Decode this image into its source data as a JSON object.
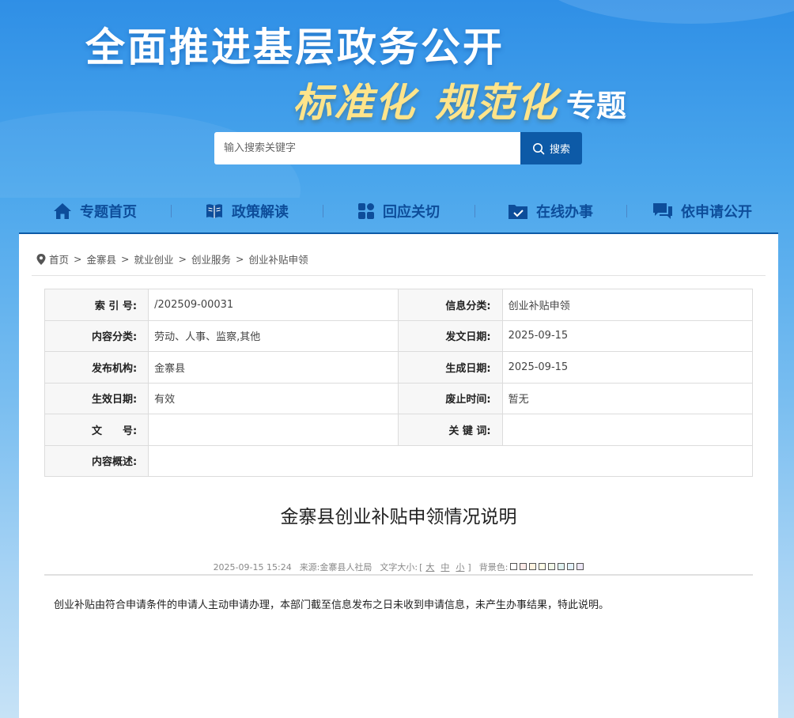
{
  "banner": {
    "title_main": "全面推进基层政务公开",
    "title_cal_1": "标准化",
    "title_cal_2": "规范化",
    "title_topic": "专题"
  },
  "search": {
    "placeholder": "输入搜索关键字",
    "button_label": "搜索"
  },
  "nav": {
    "items": [
      {
        "label": "专题首页",
        "icon": "home-icon"
      },
      {
        "label": "政策解读",
        "icon": "book-icon"
      },
      {
        "label": "回应关切",
        "icon": "grid-icon"
      },
      {
        "label": "在线办事",
        "icon": "folder-check-icon"
      },
      {
        "label": "依申请公开",
        "icon": "chat-icon"
      }
    ]
  },
  "breadcrumb": {
    "icon": "location-pin-icon",
    "items": [
      "首页",
      "金寨县",
      "就业创业",
      "创业服务",
      "创业补贴申领"
    ],
    "separator": ">"
  },
  "meta_table": {
    "rows": [
      [
        {
          "k": "索 引 号:",
          "v": "/202509-00031"
        },
        {
          "k": "信息分类:",
          "v": "创业补贴申领"
        }
      ],
      [
        {
          "k": "内容分类:",
          "v": "劳动、人事、监察,其他"
        },
        {
          "k": "发文日期:",
          "v": "2025-09-15"
        }
      ],
      [
        {
          "k": "发布机构:",
          "v": "金寨县"
        },
        {
          "k": "生成日期:",
          "v": "2025-09-15"
        }
      ],
      [
        {
          "k": "生效日期:",
          "v": "有效"
        },
        {
          "k": "废止时间:",
          "v": "暂无"
        }
      ],
      [
        {
          "k": "文　　号:",
          "v": ""
        },
        {
          "k": "关 键 词:",
          "v": ""
        }
      ]
    ],
    "summary_key": "内容概述:",
    "summary_value": ""
  },
  "article": {
    "title": "金寨县创业补贴申领情况说明",
    "datetime": "2025-09-15 15:24",
    "source_label": "来源:",
    "source": "金寨县人社局",
    "font_size_label": "文字大小:",
    "bracket_open": "[",
    "size_large": "大",
    "size_medium": "中",
    "size_small": "小",
    "bracket_close": "]",
    "bg_label": "背景色:",
    "bg_colors": [
      "#ffffff",
      "#fbe9e7",
      "#fff3e0",
      "#fffde7",
      "#f1f8e9",
      "#e0f2f1",
      "#e3f2fd",
      "#ede7f6"
    ],
    "body": "创业补贴由符合申请条件的申请人主动申请办理，本部门截至信息发布之日未收到申请信息，未产生办事结果，特此说明。"
  }
}
